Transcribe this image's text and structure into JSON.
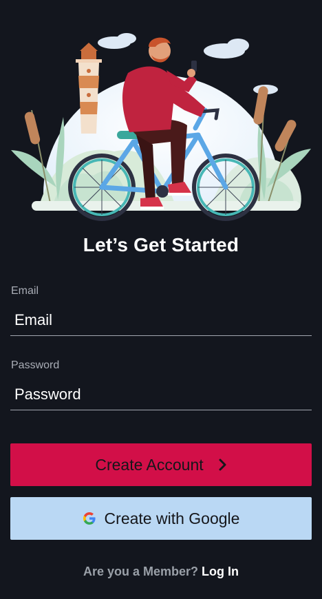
{
  "hero": {
    "illustration": "cyclist-on-bicycle-with-lighthouse-and-reeds"
  },
  "page": {
    "title": "Let’s Get Started"
  },
  "form": {
    "email_label": "Email",
    "email_placeholder": "Email",
    "password_label": "Password",
    "password_placeholder": "Password"
  },
  "buttons": {
    "create_account": "Create Account",
    "create_account_icon": "chevron-right-icon",
    "google": "Create with Google",
    "google_icon": "google-icon"
  },
  "footer": {
    "question": "Are you a Member?",
    "login": "Log In"
  },
  "colors": {
    "background": "#13161e",
    "primary": "#d20f48",
    "google_button": "#bad8f4",
    "text": "#ffffff",
    "muted": "#9aa0a8"
  }
}
